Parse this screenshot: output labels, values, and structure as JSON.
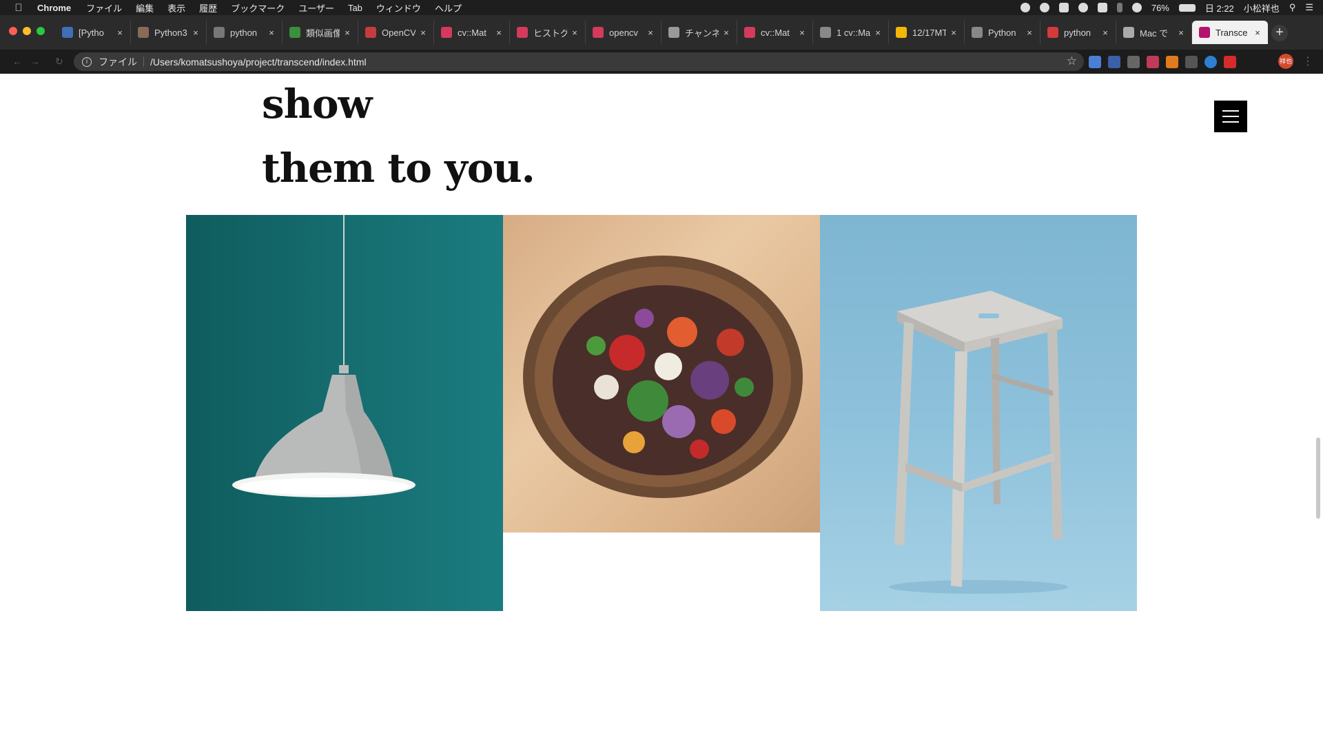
{
  "menubar": {
    "app_name": "Chrome",
    "items": [
      "ファイル",
      "編集",
      "表示",
      "履歴",
      "ブックマーク",
      "ユーザー",
      "Tab",
      "ウィンドウ",
      "ヘルプ"
    ],
    "battery": "76%",
    "clock": "日 2:22",
    "user": "小松祥也"
  },
  "tabs": [
    {
      "label": "[Pytho",
      "favicon_color": "#3f6fb5"
    },
    {
      "label": "Python3",
      "favicon_color": "#8a6a5a"
    },
    {
      "label": "python",
      "favicon_color": "#777777"
    },
    {
      "label": "類似画像",
      "favicon_color": "#3c8f3c"
    },
    {
      "label": "OpenCV",
      "favicon_color": "#c43c3c"
    },
    {
      "label": "cv::Mat",
      "favicon_color": "#d33a5c"
    },
    {
      "label": "ヒストグ",
      "favicon_color": "#d33a5c"
    },
    {
      "label": "opencv",
      "favicon_color": "#d33a5c"
    },
    {
      "label": "チャンネ",
      "favicon_color": "#999999"
    },
    {
      "label": "cv::Mat",
      "favicon_color": "#d33a5c"
    },
    {
      "label": "1 cv::Ma",
      "favicon_color": "#888888"
    },
    {
      "label": "12/17MT",
      "favicon_color": "#f2b705"
    },
    {
      "label": "Python",
      "favicon_color": "#888888"
    },
    {
      "label": "python",
      "favicon_color": "#d33a3a"
    },
    {
      "label": "Mac で",
      "favicon_color": "#aaaaaa"
    },
    {
      "label": "Transce",
      "favicon_color": "#b3126f",
      "active": true
    }
  ],
  "toolbar": {
    "url_scheme": "ファイル",
    "url": "/Users/komatsushoya/project/transcend/index.html",
    "profile_badge": "祥也"
  },
  "page": {
    "heading_line1": "projects and we are so excited to show",
    "heading_line2": "them to you.",
    "images": [
      {
        "name": "photo-lamp",
        "subject": "pendant lamp on teal wall"
      },
      {
        "name": "photo-salad",
        "subject": "bowl of salad on wooden table"
      },
      {
        "name": "photo-stool",
        "subject": "wooden stool on blue background"
      }
    ]
  },
  "colors": {
    "accent": "#000000",
    "lamp_bg": "#156b6d",
    "stool_bg": "#8fc2dc",
    "salad_bg": "#e2bd95"
  }
}
